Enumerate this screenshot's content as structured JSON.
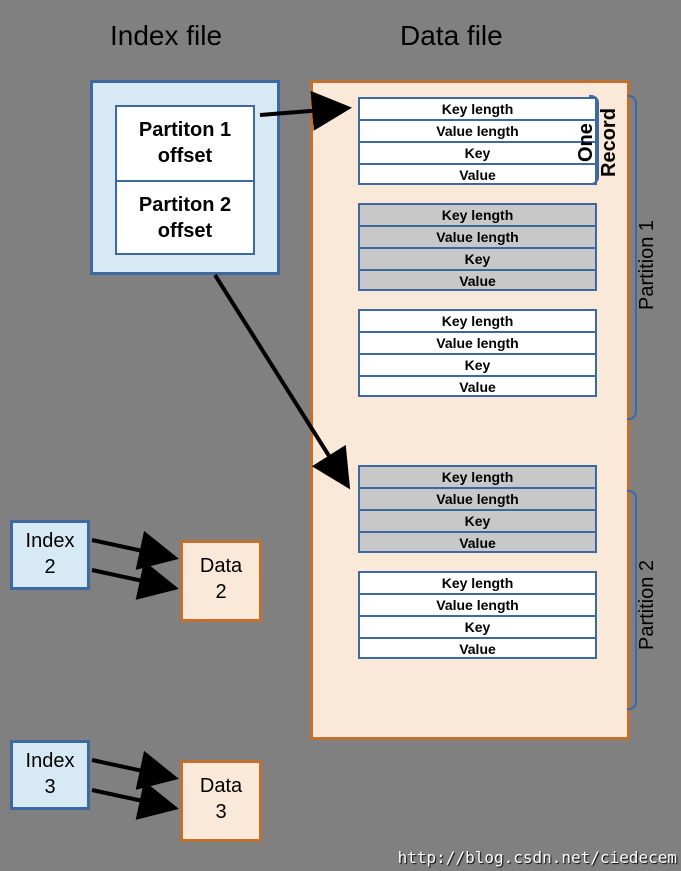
{
  "titles": {
    "index": "Index file",
    "data": "Data file"
  },
  "index_main": {
    "offsets": [
      {
        "line1": "Partiton 1",
        "line2": "offset"
      },
      {
        "line1": "Partiton 2",
        "line2": "offset"
      }
    ]
  },
  "smallboxes": {
    "idx2": {
      "line1": "Index",
      "line2": "2"
    },
    "dat2": {
      "line1": "Data",
      "line2": "2"
    },
    "idx3": {
      "line1": "Index",
      "line2": "3"
    },
    "dat3": {
      "line1": "Data",
      "line2": "3"
    }
  },
  "record_fields": [
    "Key length",
    "Value length",
    "Key",
    "Value"
  ],
  "vlabels": {
    "one_record": "One Record",
    "p1": "Partition 1",
    "p2": "Partition 2"
  },
  "watermark": "http://blog.csdn.net/ciedecem"
}
